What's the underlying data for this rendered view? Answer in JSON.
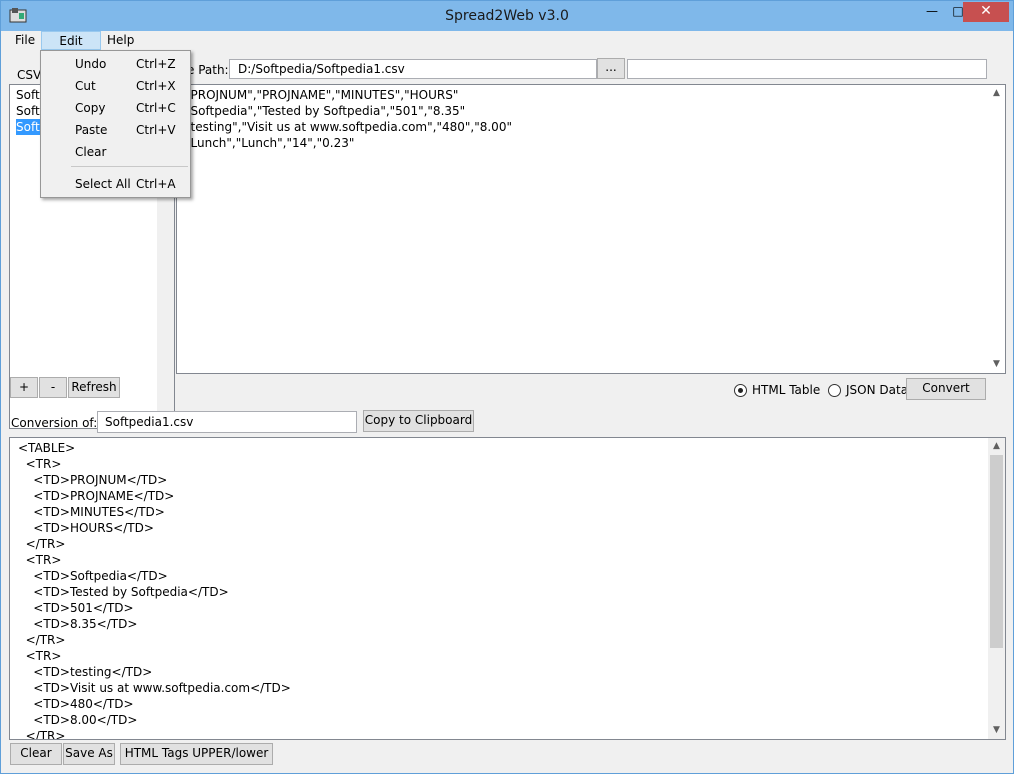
{
  "window": {
    "title": "Spread2Web v3.0"
  },
  "menu": {
    "file": "File",
    "edit": "Edit",
    "help": "Help"
  },
  "edit_menu": [
    {
      "label": "Undo",
      "shortcut": "Ctrl+Z"
    },
    {
      "label": "Cut",
      "shortcut": "Ctrl+X"
    },
    {
      "label": "Copy",
      "shortcut": "Ctrl+C"
    },
    {
      "label": "Paste",
      "shortcut": "Ctrl+V"
    },
    {
      "label": "Clear",
      "shortcut": ""
    },
    {
      "label": "Select All",
      "shortcut": "Ctrl+A"
    }
  ],
  "left_panel": {
    "label": "CSV",
    "files": [
      "Softp",
      "Softp",
      "Softp"
    ],
    "selected_index": 2
  },
  "path": {
    "label": "e Path:",
    "value": "D:/Softpedia/Softpedia1.csv",
    "browse": "..."
  },
  "csv_lines": [
    "\"PROJNUM\",\"PROJNAME\",\"MINUTES\",\"HOURS\"",
    "\"Softpedia\",\"Tested by Softpedia\",\"501\",\"8.35\"",
    "\"testing\",\"Visit us at www.softpedia.com\",\"480\",\"8.00\"",
    "\"Lunch\",\"Lunch\",\"14\",\"0.23\""
  ],
  "list_buttons": {
    "add": "+",
    "remove": "-",
    "refresh": "Refresh"
  },
  "format": {
    "html": "HTML Table",
    "json": "JSON Data",
    "selected": "html",
    "convert": "Convert"
  },
  "conversion": {
    "label": "Conversion of:",
    "value": "Softpedia1.csv",
    "copy": "Copy to Clipboard"
  },
  "output_lines": [
    "<TABLE>",
    "  <TR>",
    "    <TD>PROJNUM</TD>",
    "    <TD>PROJNAME</TD>",
    "    <TD>MINUTES</TD>",
    "    <TD>HOURS</TD>",
    "  </TR>",
    "  <TR>",
    "    <TD>Softpedia</TD>",
    "    <TD>Tested by Softpedia</TD>",
    "    <TD>501</TD>",
    "    <TD>8.35</TD>",
    "  </TR>",
    "  <TR>",
    "    <TD>testing</TD>",
    "    <TD>Visit us at www.softpedia.com</TD>",
    "    <TD>480</TD>",
    "    <TD>8.00</TD>",
    "  </TR>"
  ],
  "bottom_buttons": {
    "clear": "Clear",
    "save_as": "Save As",
    "case": "HTML Tags UPPER/lower"
  },
  "colors": {
    "titlebar": "#7fb8ea",
    "selection": "#3399ff",
    "close": "#c75050"
  }
}
